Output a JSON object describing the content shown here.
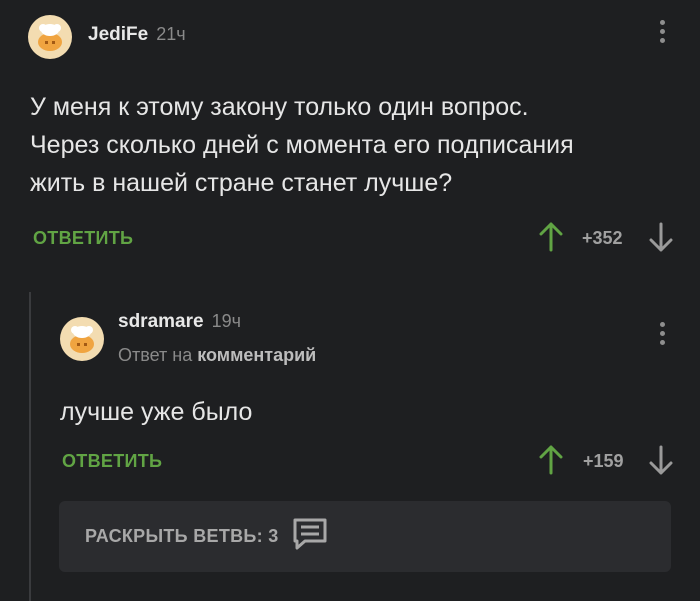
{
  "comment": {
    "username": "JediFe",
    "time": "21ч",
    "text_lines": [
      "У меня к этому закону только один вопрос.",
      "Через сколько дней с момента его подписания",
      "жить в нашей стране станет лучше?"
    ],
    "reply_label": "ОТВЕТИТЬ",
    "rating": "+352"
  },
  "reply": {
    "username": "sdramare",
    "time": "19ч",
    "reply_to_prefix": "Ответ на",
    "reply_to_target": "комментарий",
    "text": "лучше уже было",
    "reply_label": "ОТВЕТИТЬ",
    "rating": "+159"
  },
  "expand_thread": {
    "label": "РАСКРЫТЬ ВЕТВЬ: 3"
  },
  "colors": {
    "background": "#1e1f21",
    "accent_green": "#61a444",
    "muted": "#8a8a8a",
    "panel": "#2b2c2f"
  }
}
